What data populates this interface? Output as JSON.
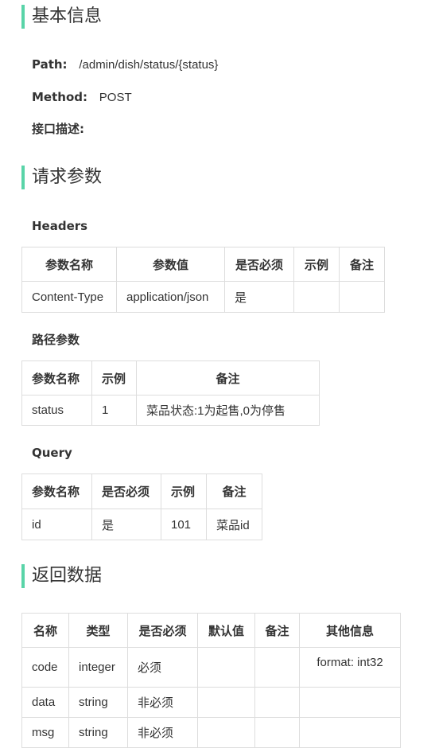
{
  "basic": {
    "title": "基本信息",
    "path_label": "Path:",
    "path_value": "/admin/dish/status/{status}",
    "method_label": "Method:",
    "method_value": "POST",
    "desc_label": "接口描述:"
  },
  "request": {
    "title": "请求参数",
    "headers_title": "Headers",
    "headers_table": {
      "columns": [
        "参数名称",
        "参数值",
        "是否必须",
        "示例",
        "备注"
      ],
      "rows": [
        [
          "Content-Type",
          "application/json",
          "是",
          "",
          ""
        ]
      ]
    },
    "path_title": "路径参数",
    "path_table": {
      "columns": [
        "参数名称",
        "示例",
        "备注"
      ],
      "rows": [
        [
          "status",
          "1",
          "菜品状态:1为起售,0为停售"
        ]
      ]
    },
    "query_title": "Query",
    "query_table": {
      "columns": [
        "参数名称",
        "是否必须",
        "示例",
        "备注"
      ],
      "rows": [
        [
          "id",
          "是",
          "101",
          "菜品id"
        ]
      ]
    }
  },
  "response": {
    "title": "返回数据",
    "table": {
      "columns": [
        "名称",
        "类型",
        "是否必须",
        "默认值",
        "备注",
        "其他信息"
      ],
      "rows": [
        [
          "code",
          "integer",
          "必须",
          "",
          "",
          "format: int32"
        ],
        [
          "data",
          "string",
          "非必须",
          "",
          "",
          ""
        ],
        [
          "msg",
          "string",
          "非必须",
          "",
          "",
          ""
        ]
      ]
    }
  }
}
